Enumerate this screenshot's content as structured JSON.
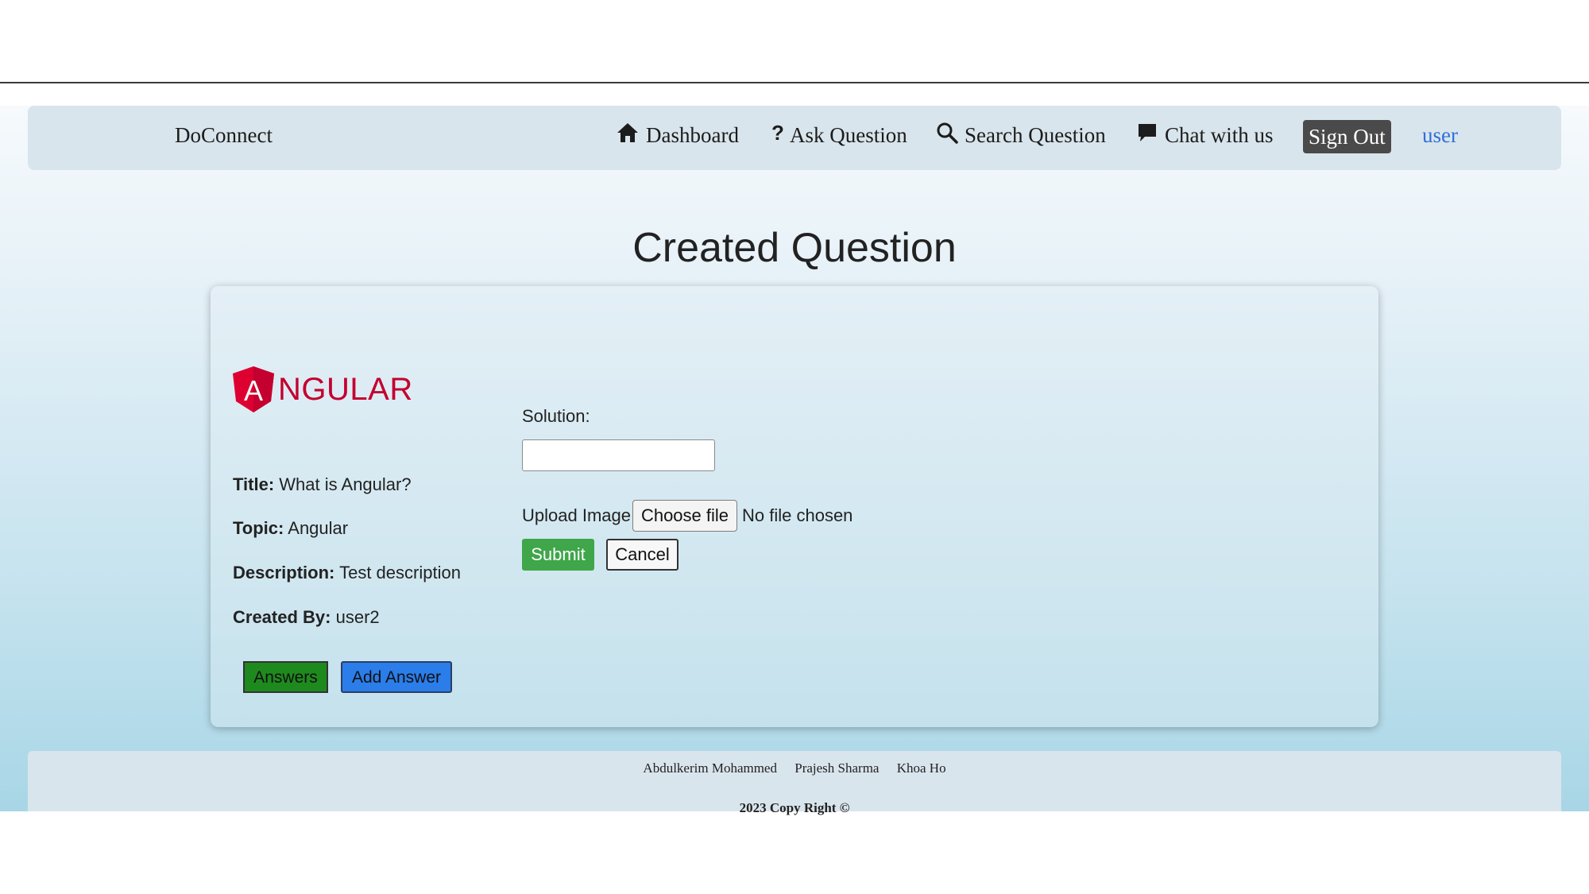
{
  "navbar": {
    "brand": "DoConnect",
    "items": [
      {
        "label": "Dashboard",
        "icon": "home-icon"
      },
      {
        "label": "Ask Question",
        "icon": "question-icon"
      },
      {
        "label": "Search Question",
        "icon": "search-icon"
      },
      {
        "label": "Chat with us",
        "icon": "chat-icon"
      }
    ],
    "sign_out": "Sign Out",
    "user": "user"
  },
  "page": {
    "title": "Created Question"
  },
  "question": {
    "logo_text": "NGULAR",
    "logo_letter": "A",
    "title_label": "Title:",
    "title_value": "What is Angular?",
    "topic_label": "Topic:",
    "topic_value": "Angular",
    "description_label": "Description:",
    "description_value": "Test description",
    "created_by_label": "Created By:",
    "created_by_value": "user2",
    "answers_button": "Answers",
    "add_answer_button": "Add Answer"
  },
  "answer_form": {
    "solution_label": "Solution:",
    "solution_value": "",
    "upload_label": "Upload Image",
    "choose_file": "Choose file",
    "no_file": "No file chosen",
    "submit": "Submit",
    "cancel": "Cancel"
  },
  "footer": {
    "authors": [
      "Abdulkerim Mohammed",
      "Prajesh Sharma",
      "Khoa Ho"
    ],
    "copyright": "2023 Copy Right ©"
  },
  "colors": {
    "sign_out_bg": "#4a4a4a",
    "user_link": "#2f6fd8",
    "answers_button": "#1e8a1e",
    "add_answer_button": "#2b7de9",
    "submit_button": "#3fa64a",
    "angular_red": "#c3002f"
  }
}
